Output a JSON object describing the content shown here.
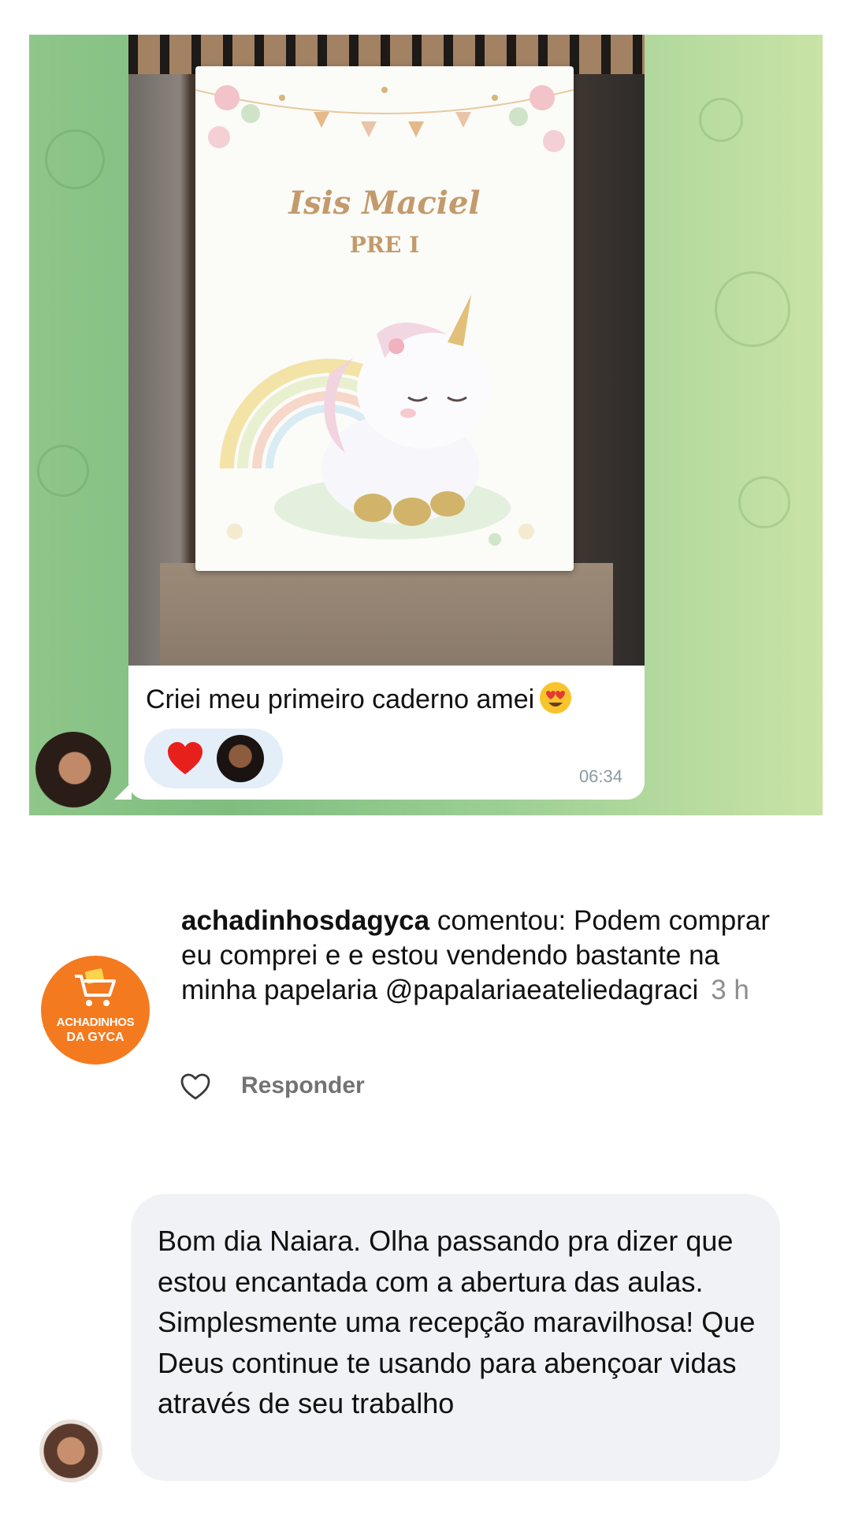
{
  "chat": {
    "notebook_name": "Isis Maciel",
    "notebook_class": "PRE I",
    "caption": "Criei meu primeiro caderno amei",
    "caption_emoji": "heart-eyes-emoji",
    "reaction": "heart-emoji",
    "time": "06:34"
  },
  "comment": {
    "avatar_line1": "ACHADINHOS",
    "avatar_line2": "DA GYCA",
    "username": "achadinhosdagyca",
    "text": " comentou: Podem comprar eu comprei e e estou vendendo bastante na minha papelaria @papalariaeateliedagraci",
    "age": "3 h",
    "like_icon": "heart-outline-icon",
    "reply_label": "Responder"
  },
  "message": {
    "text": "Bom dia Naiara. Olha passando pra dizer que estou encantada com a abertura das aulas. Simplesmente uma recepção maravilhosa! Que Deus continue te usando para abençoar vidas através de seu trabalho"
  },
  "colors": {
    "chat_background": "#8fc68a",
    "brand_orange": "#f47a1f",
    "reaction_pill": "#e4eef8",
    "message_bubble": "#f0f2f5",
    "meta_gray": "#8e8e8e"
  }
}
